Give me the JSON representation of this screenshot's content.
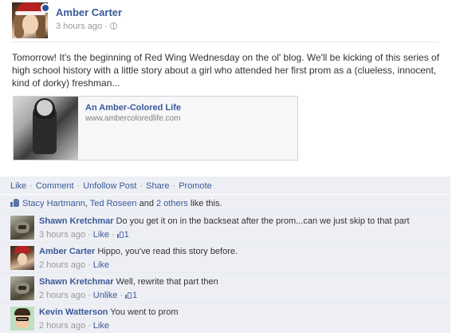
{
  "post": {
    "author": "Amber Carter",
    "time": "3 hours ago",
    "text": "Tomorrow! It's the beginning of Red Wing Wednesday on the ol' blog. We'll be kicking of this series of high school history with a little story about a girl who attended her first prom as a (clueless, innocent, kind of dorky) freshman...",
    "link": {
      "title": "An Amber-Colored Life",
      "url": "www.ambercoloredlife.com"
    }
  },
  "actions": {
    "like": "Like",
    "comment": "Comment",
    "unfollow": "Unfollow Post",
    "share": "Share",
    "promote": "Promote"
  },
  "likes": {
    "name1": "Stacy Hartmann",
    "name2": "Ted Roseen",
    "and": "and",
    "others": "2 others",
    "suffix": "like this."
  },
  "comments": [
    {
      "author": "Shawn Kretchmar",
      "text": "Do you get it on in the backseat after the prom...can we just skip to that part",
      "time": "3 hours ago",
      "action": "Like",
      "likes": "1"
    },
    {
      "author": "Amber Carter",
      "text": "Hippo, you've read this story before.",
      "time": "2 hours ago",
      "action": "Like",
      "likes": ""
    },
    {
      "author": "Shawn Kretchmar",
      "text": "Well, rewrite that part then",
      "time": "2 hours ago",
      "action": "Unlike",
      "likes": "1"
    },
    {
      "author": "Kevin Watterson",
      "text": "You went to prom",
      "time": "2 hours ago",
      "action": "Like",
      "likes": ""
    }
  ],
  "colors": {
    "link": "#3b5998",
    "ufi_bg": "#edeff4",
    "meta": "#999999"
  }
}
